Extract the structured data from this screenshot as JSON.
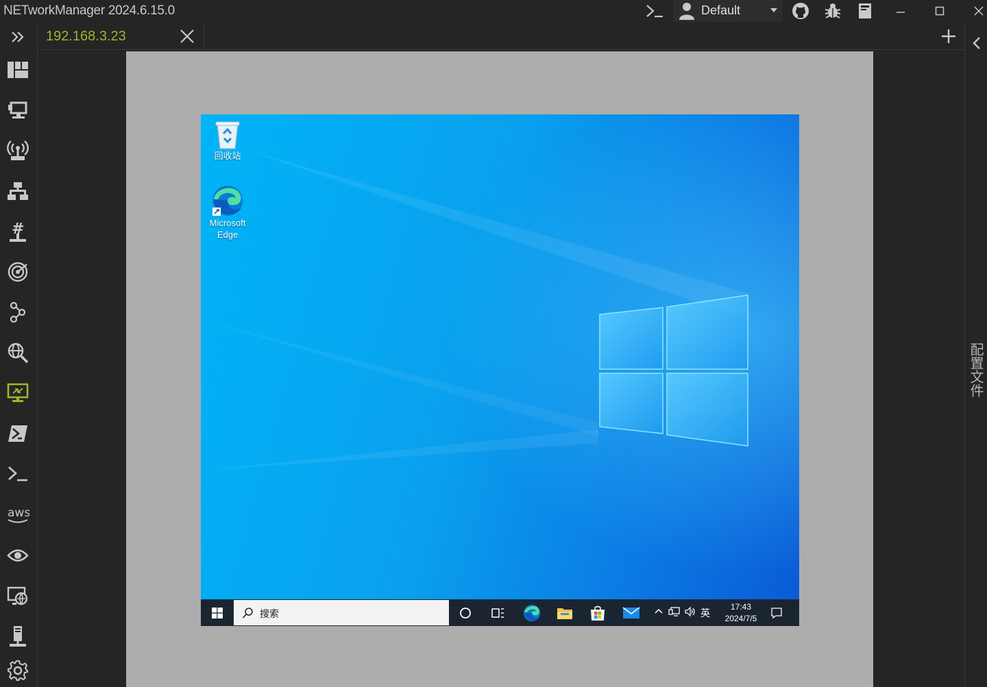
{
  "app": {
    "title": "NETworkManager 2024.6.15.0",
    "profile": "Default"
  },
  "tabs": [
    {
      "label": "192.168.3.23"
    }
  ],
  "right_panel": {
    "label": "配置文件"
  },
  "nav": [
    {
      "name": "dashboard-icon"
    },
    {
      "name": "network-interface-icon"
    },
    {
      "name": "wifi-icon"
    },
    {
      "name": "ip-scanner-icon"
    },
    {
      "name": "port-scanner-icon"
    },
    {
      "name": "ping-monitor-icon"
    },
    {
      "name": "traceroute-icon"
    },
    {
      "name": "dns-lookup-icon"
    },
    {
      "name": "remote-desktop-icon"
    },
    {
      "name": "powershell-icon"
    },
    {
      "name": "putty-icon"
    },
    {
      "name": "aws-icon"
    },
    {
      "name": "tigervnc-icon"
    },
    {
      "name": "web-console-icon"
    },
    {
      "name": "snmp-icon"
    },
    {
      "name": "settings-icon"
    }
  ],
  "remote_desktop": {
    "desktop_icons": [
      {
        "label": "回收站"
      },
      {
        "label_line1": "Microsoft",
        "label_line2": "Edge"
      }
    ],
    "taskbar": {
      "search_placeholder": "搜索",
      "ime": "英",
      "time": "17:43",
      "date": "2024/7/5"
    }
  },
  "colors": {
    "accent": "#9bb82a",
    "background": "#252525",
    "rdp_frame": "#adadad",
    "taskbar": "#1b2532"
  }
}
